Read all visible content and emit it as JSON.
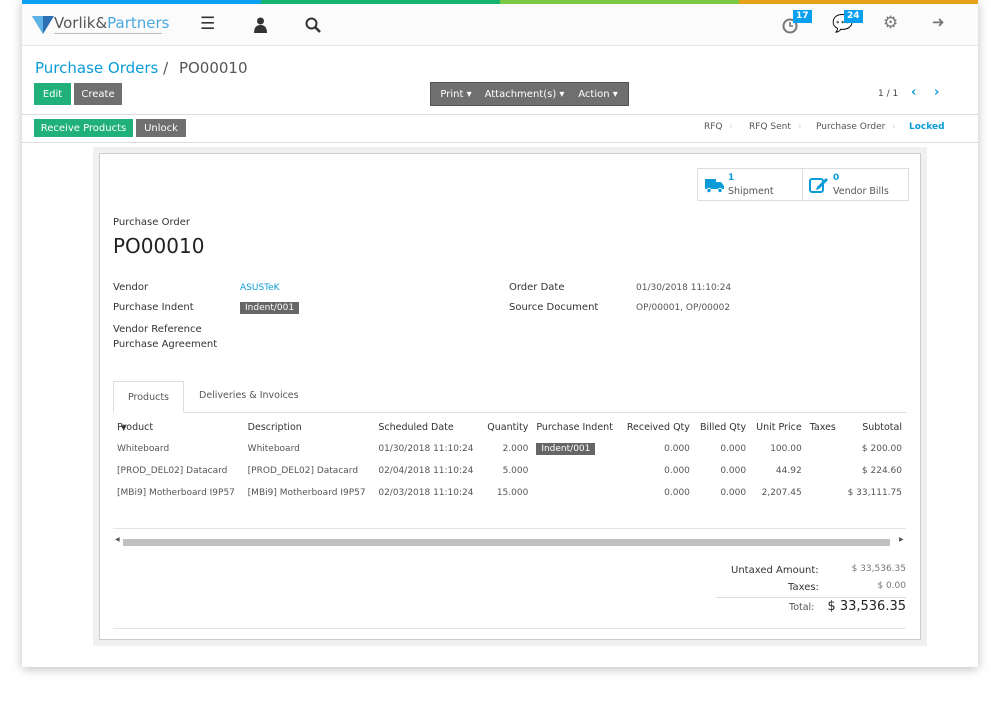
{
  "colors": {
    "topline": [
      "#0aa0f0",
      "#16b26f",
      "#7ac943",
      "#e3a21a"
    ],
    "accent": "#0a9cd9",
    "primary": "#20b07a",
    "gray_button": "#6f6f6f"
  },
  "header": {
    "logo": {
      "text_a": "Vorlik&",
      "text_b": "Partners"
    },
    "icons": [
      "menu-icon",
      "user-icon",
      "search-icon",
      "clock-icon",
      "chat-icon",
      "gears-icon",
      "logout-icon"
    ],
    "activity_count": "17",
    "message_count": "24"
  },
  "breadcrumb": {
    "parent": "Purchase Orders",
    "separator": "/",
    "current": "PO00010"
  },
  "buttons": {
    "edit": "Edit",
    "create": "Create",
    "print": "Print",
    "attachments": "Attachment(s)",
    "action": "Action",
    "receive": "Receive Products",
    "unlock": "Unlock"
  },
  "pager": {
    "value": "1 / 1"
  },
  "statusbar": {
    "stages": [
      "RFQ",
      "RFQ Sent",
      "Purchase Order",
      "Locked"
    ],
    "active": "Locked"
  },
  "smart_buttons": [
    {
      "count": "1",
      "label": "Shipment"
    },
    {
      "count": "0",
      "label": "Vendor Bills"
    }
  ],
  "form": {
    "type_label": "Purchase Order",
    "name": "PO00010",
    "vendor_label": "Vendor",
    "vendor": "ASUSTeK",
    "indent_label": "Purchase Indent",
    "indent": "Indent/001",
    "vendor_ref_label": "Vendor Reference",
    "agreement_label": "Purchase Agreement",
    "order_date_label": "Order Date",
    "order_date": "01/30/2018 11:10:24",
    "source_label": "Source Document",
    "source": "OP/00001, OP/00002"
  },
  "tabs": [
    "Products",
    "Deliveries & Invoices"
  ],
  "table": {
    "columns": [
      "Product",
      "Description",
      "Scheduled Date",
      "Quantity",
      "Purchase Indent",
      "Received Qty",
      "Billed Qty",
      "Unit Price",
      "Taxes",
      "Subtotal"
    ],
    "rows": [
      [
        "Whiteboard",
        "Whiteboard",
        "01/30/2018 11:10:24",
        "2.000",
        "Indent/001",
        "0.000",
        "0.000",
        "100.00",
        "",
        "$ 200.00"
      ],
      [
        "[PROD_DEL02] Datacard",
        "[PROD_DEL02] Datacard",
        "02/04/2018 11:10:24",
        "5.000",
        "",
        "0.000",
        "0.000",
        "44.92",
        "",
        "$ 224.60"
      ],
      [
        "[MBi9] Motherboard I9P57",
        "[MBi9] Motherboard I9P57",
        "02/03/2018 11:10:24",
        "15.000",
        "",
        "0.000",
        "0.000",
        "2,207.45",
        "",
        "$ 33,111.75"
      ]
    ]
  },
  "totals": {
    "untaxed_label": "Untaxed Amount:",
    "untaxed": "$ 33,536.35",
    "taxes_label": "Taxes:",
    "taxes": "$ 0.00",
    "total_label": "Total:",
    "total": "$ 33,536.35"
  }
}
